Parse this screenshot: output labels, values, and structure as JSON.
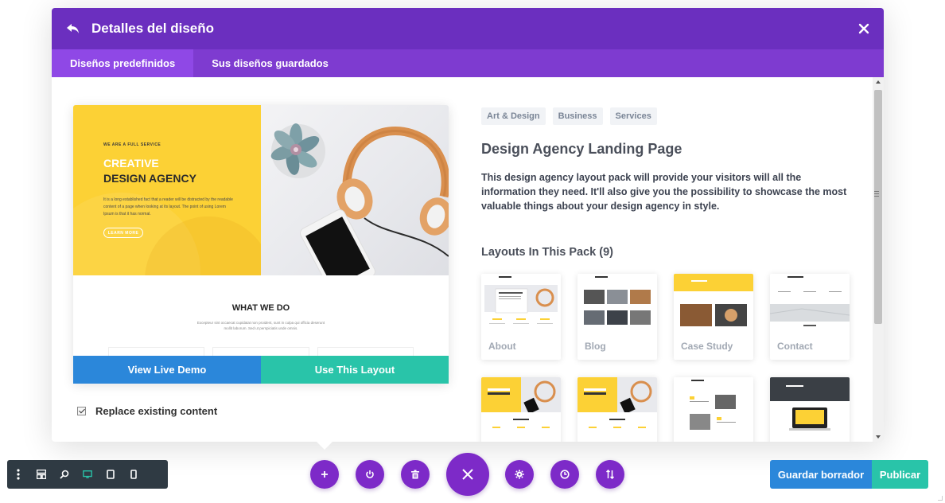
{
  "modal": {
    "title": "Detalles del diseño",
    "tabs": [
      {
        "label": "Diseños predefinidos",
        "active": true
      },
      {
        "label": "Sus diseños guardados",
        "active": false
      }
    ]
  },
  "preview": {
    "kicker": "WE ARE A FULL SERVICE",
    "title_line1": "CREATIVE",
    "title_line2": "DESIGN AGENCY",
    "body": "It is a long established fact that a reader will be distracted by the readable content of a page when looking at its layout. The point of using Lorem Ipsum is that it has normal.",
    "hero_button": "LEARN MORE",
    "section_title": "WHAT WE DO",
    "section_body": "Excepteur sint occaecat cupidatat non proident, sunt in culpa qui officia deserunt mollit laborum. Sed ut perspiciatis unde omnis."
  },
  "actions": {
    "live_demo": "View Live Demo",
    "use_layout": "Use This Layout",
    "replace_label": "Replace existing content",
    "replace_checked": true
  },
  "details": {
    "tags": [
      "Art & Design",
      "Business",
      "Services"
    ],
    "pack_title": "Design Agency Landing Page",
    "description": "This design agency layout pack will provide your visitors will all the information they need. It'll also give you the possibility to showcase the most valuable things about your design agency in style.",
    "layouts_title": "Layouts In This Pack (9)",
    "layouts": [
      {
        "name": "About",
        "thumb": "about"
      },
      {
        "name": "Blog",
        "thumb": "blog"
      },
      {
        "name": "Case Study",
        "thumb": "case"
      },
      {
        "name": "Contact",
        "thumb": "contact"
      },
      {
        "name": "",
        "thumb": "home-yellow"
      },
      {
        "name": "",
        "thumb": "landing-yellow"
      },
      {
        "name": "",
        "thumb": "portfolio"
      },
      {
        "name": "",
        "thumb": "dark-project"
      }
    ]
  },
  "toolbar": {
    "left_icons": [
      "more-vertical-icon",
      "layout-icon",
      "zoom-icon",
      "desktop-icon",
      "tablet-icon",
      "phone-icon"
    ],
    "center_icons": [
      "plus-icon",
      "power-icon",
      "trash-icon",
      "close-icon",
      "gear-icon",
      "history-icon",
      "sort-icon"
    ],
    "draft": "Guardar borrador",
    "publish": "Publicar"
  },
  "colors": {
    "header": "#6b2fbf",
    "tabs": "#7e3bd0",
    "tab_active": "#8f48e6",
    "blue": "#2b87da",
    "teal": "#29c4a9",
    "yellow": "#fcd135",
    "purple_button": "#7d2ac8"
  }
}
